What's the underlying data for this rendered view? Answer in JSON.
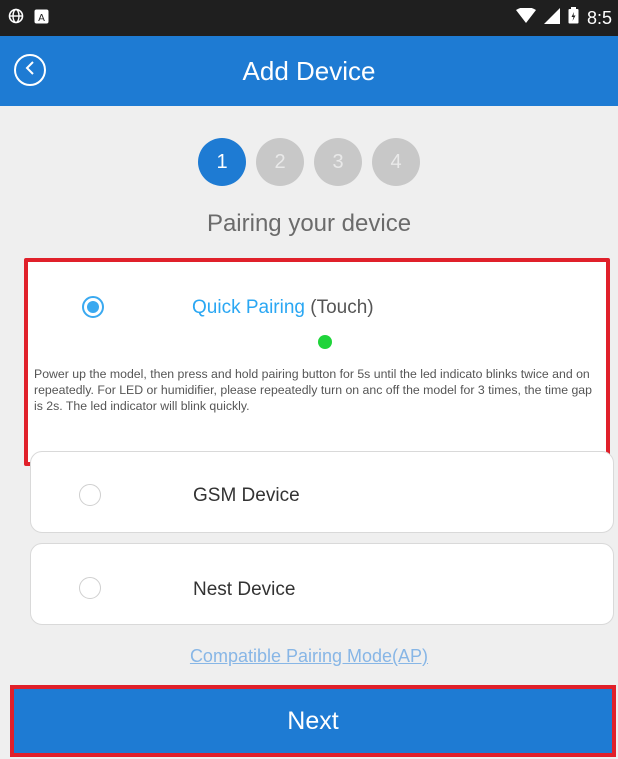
{
  "status_bar": {
    "time": "8:5",
    "icons": [
      "globe-icon",
      "notification-icon",
      "wifi-icon",
      "signal-icon",
      "battery-icon"
    ]
  },
  "header": {
    "title": "Add Device",
    "back_icon": "chevron-left-circle-icon"
  },
  "steps": {
    "items": [
      "1",
      "2",
      "3",
      "4"
    ],
    "active_index": 0
  },
  "subtitle": "Pairing your device",
  "options": {
    "quick": {
      "title": "Quick Pairing",
      "subtitle": "(Touch)",
      "selected": true,
      "description": "Power up the model, then press and hold pairing button for 5s until the led indicato blinks twice and on repeatedly. For LED or humidifier, please repeatedly turn on anc off the model for 3 times, the time gap is 2s. The led indicator will blink quickly."
    },
    "gsm": {
      "label": "GSM Device",
      "selected": false
    },
    "nest": {
      "label": "Nest Device",
      "selected": false
    }
  },
  "compat_link": "Compatible Pairing Mode(AP)",
  "next_button": "Next",
  "colors": {
    "primary": "#1e7bd3",
    "highlight": "#e0202a",
    "radio_accent": "#3aa9f0",
    "led": "#1fd43a"
  }
}
